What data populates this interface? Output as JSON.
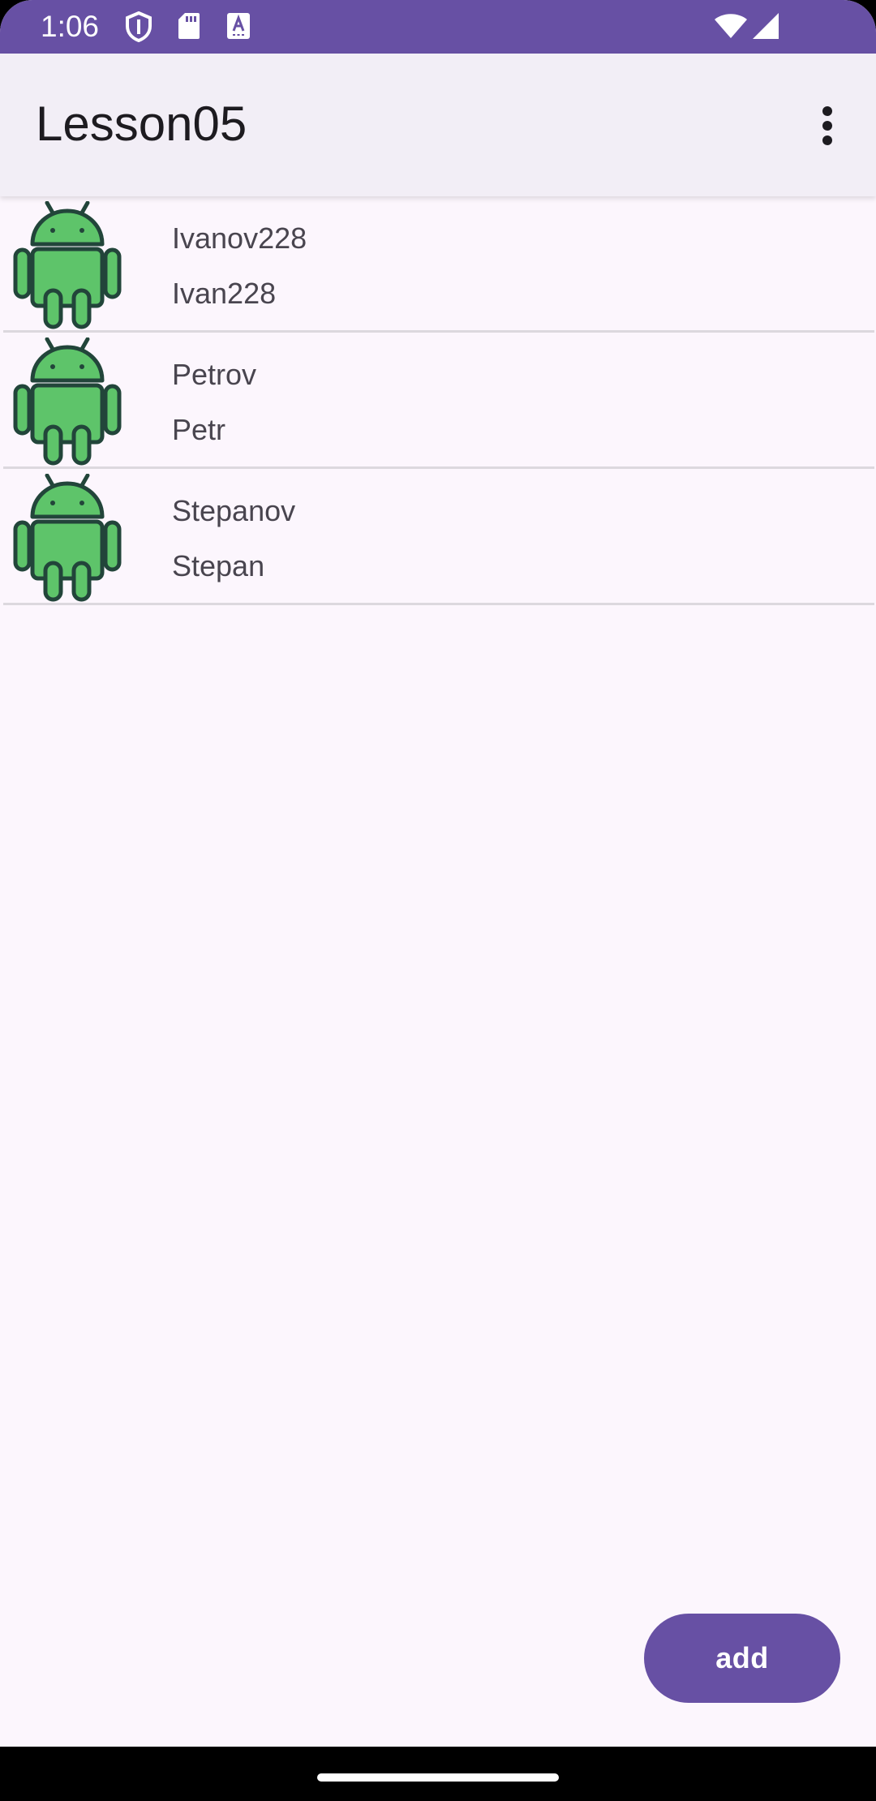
{
  "status_bar": {
    "time": "1:06",
    "background": "#6750A4",
    "icons": [
      "shield-icon",
      "sd-card-icon",
      "keyboard-a-icon",
      "wifi-icon",
      "cellular-signal-icon"
    ]
  },
  "app_bar": {
    "title": "Lesson05",
    "overflow_icon": "more-vert-icon"
  },
  "list": {
    "items": [
      {
        "line1": "Ivanov228",
        "line2": "Ivan228",
        "icon": "android-icon"
      },
      {
        "line1": "Petrov",
        "line2": "Petr",
        "icon": "android-icon"
      },
      {
        "line1": "Stepanov",
        "line2": "Stepan",
        "icon": "android-icon"
      }
    ]
  },
  "fab": {
    "label": "add"
  },
  "colors": {
    "primary": "#6750A4",
    "surface": "#FCF6FD",
    "app_bar": "#F2EEF6",
    "android_green": "#5EC46A",
    "android_outline": "#22453A"
  }
}
